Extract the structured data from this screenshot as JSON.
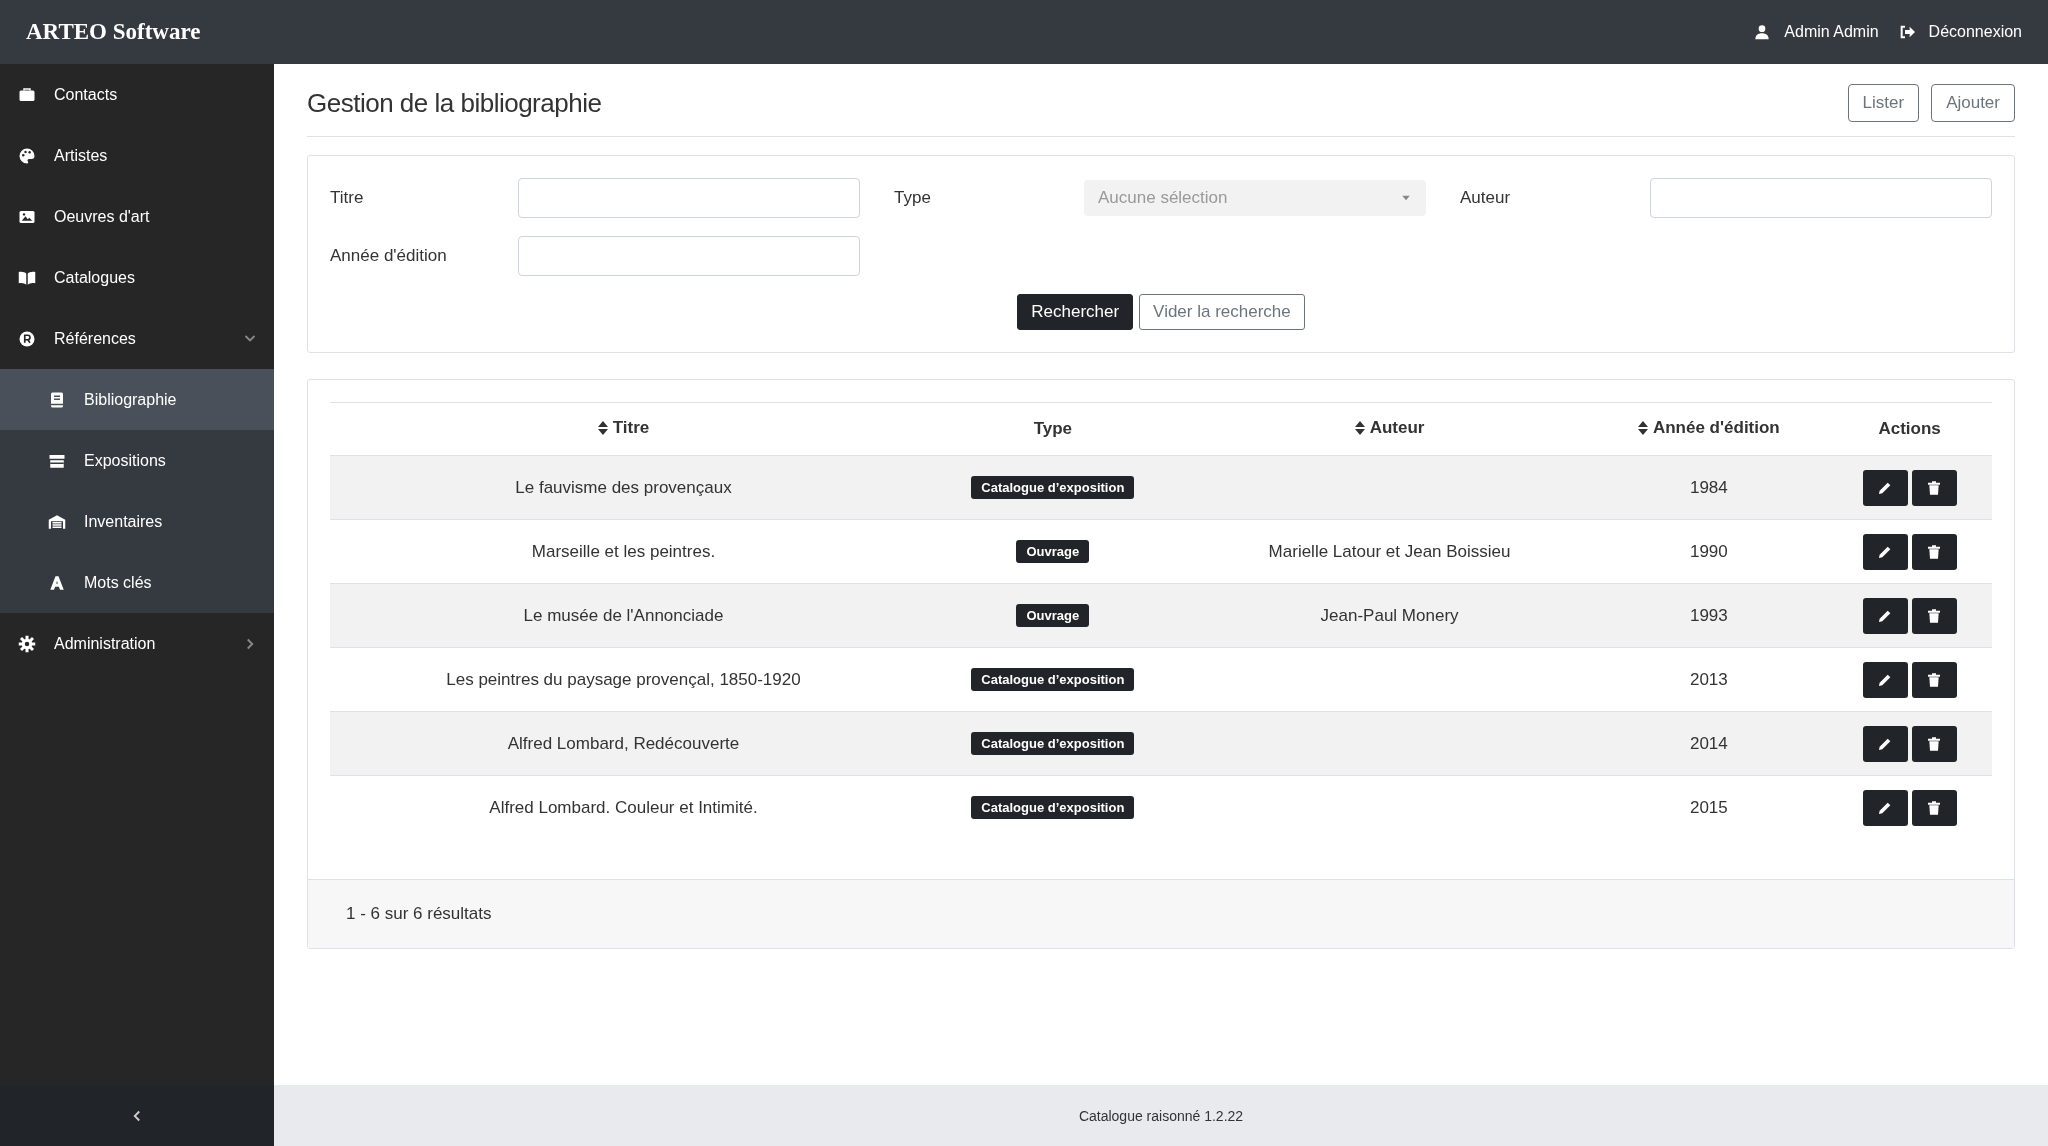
{
  "app": {
    "title": "ARTEO Software",
    "user": "Admin Admin",
    "logout": "Déconnexion"
  },
  "sidebar": {
    "items": [
      {
        "label": "Contacts",
        "selected": false
      },
      {
        "label": "Artistes",
        "selected": false
      },
      {
        "label": "Oeuvres d'art",
        "selected": false
      },
      {
        "label": "Catalogues",
        "selected": false
      },
      {
        "label": "Références",
        "selected": false,
        "expanded": true,
        "children": [
          {
            "label": "Bibliographie",
            "selected": true
          },
          {
            "label": "Expositions",
            "selected": false
          },
          {
            "label": "Inventaires",
            "selected": false
          },
          {
            "label": "Mots clés",
            "selected": false
          }
        ]
      },
      {
        "label": "Administration",
        "selected": false,
        "expanded": false
      }
    ]
  },
  "page": {
    "title": "Gestion de la bibliographie",
    "buttons": [
      "Lister",
      "Ajouter"
    ]
  },
  "filters": {
    "fields": [
      {
        "label": "Titre",
        "kind": "text"
      },
      {
        "label": "Type",
        "kind": "select",
        "placeholder": "Aucune sélection"
      },
      {
        "label": "Auteur",
        "kind": "text"
      },
      {
        "label": "Année d'édition",
        "kind": "text"
      }
    ],
    "search_button": "Rechercher",
    "clear_button": "Vider la recherche"
  },
  "table": {
    "columns": [
      {
        "label": "Titre",
        "sortable": true
      },
      {
        "label": "Type",
        "sortable": false
      },
      {
        "label": "Auteur",
        "sortable": true
      },
      {
        "label": "Année d'édition",
        "sortable": true
      },
      {
        "label": "Actions",
        "sortable": false
      }
    ],
    "rows": [
      {
        "titre": "Le fauvisme des provençaux",
        "type": "Catalogue d’exposition",
        "annee": "1984"
      },
      {
        "titre": "Marseille et les peintres.",
        "type": "Ouvrage",
        "auteur": "Marielle Latour et Jean Boissieu",
        "annee": "1990"
      },
      {
        "titre": "Le musée de l'Annonciade",
        "type": "Ouvrage",
        "auteur": "Jean-Paul Monery",
        "annee": "1993"
      },
      {
        "titre": "Les peintres du paysage provençal, 1850-1920",
        "type": "Catalogue d’exposition",
        "annee": "2013"
      },
      {
        "titre": "Alfred Lombard, Redécouverte",
        "type": "Catalogue d’exposition",
        "annee": "2014"
      },
      {
        "titre": "Alfred Lombard. Couleur et Intimité.",
        "type": "Catalogue d’exposition",
        "annee": "2015"
      }
    ],
    "summary": "1 - 6 sur 6 résultats"
  },
  "footer": {
    "version": "Catalogue raisonné 1.2.22"
  }
}
